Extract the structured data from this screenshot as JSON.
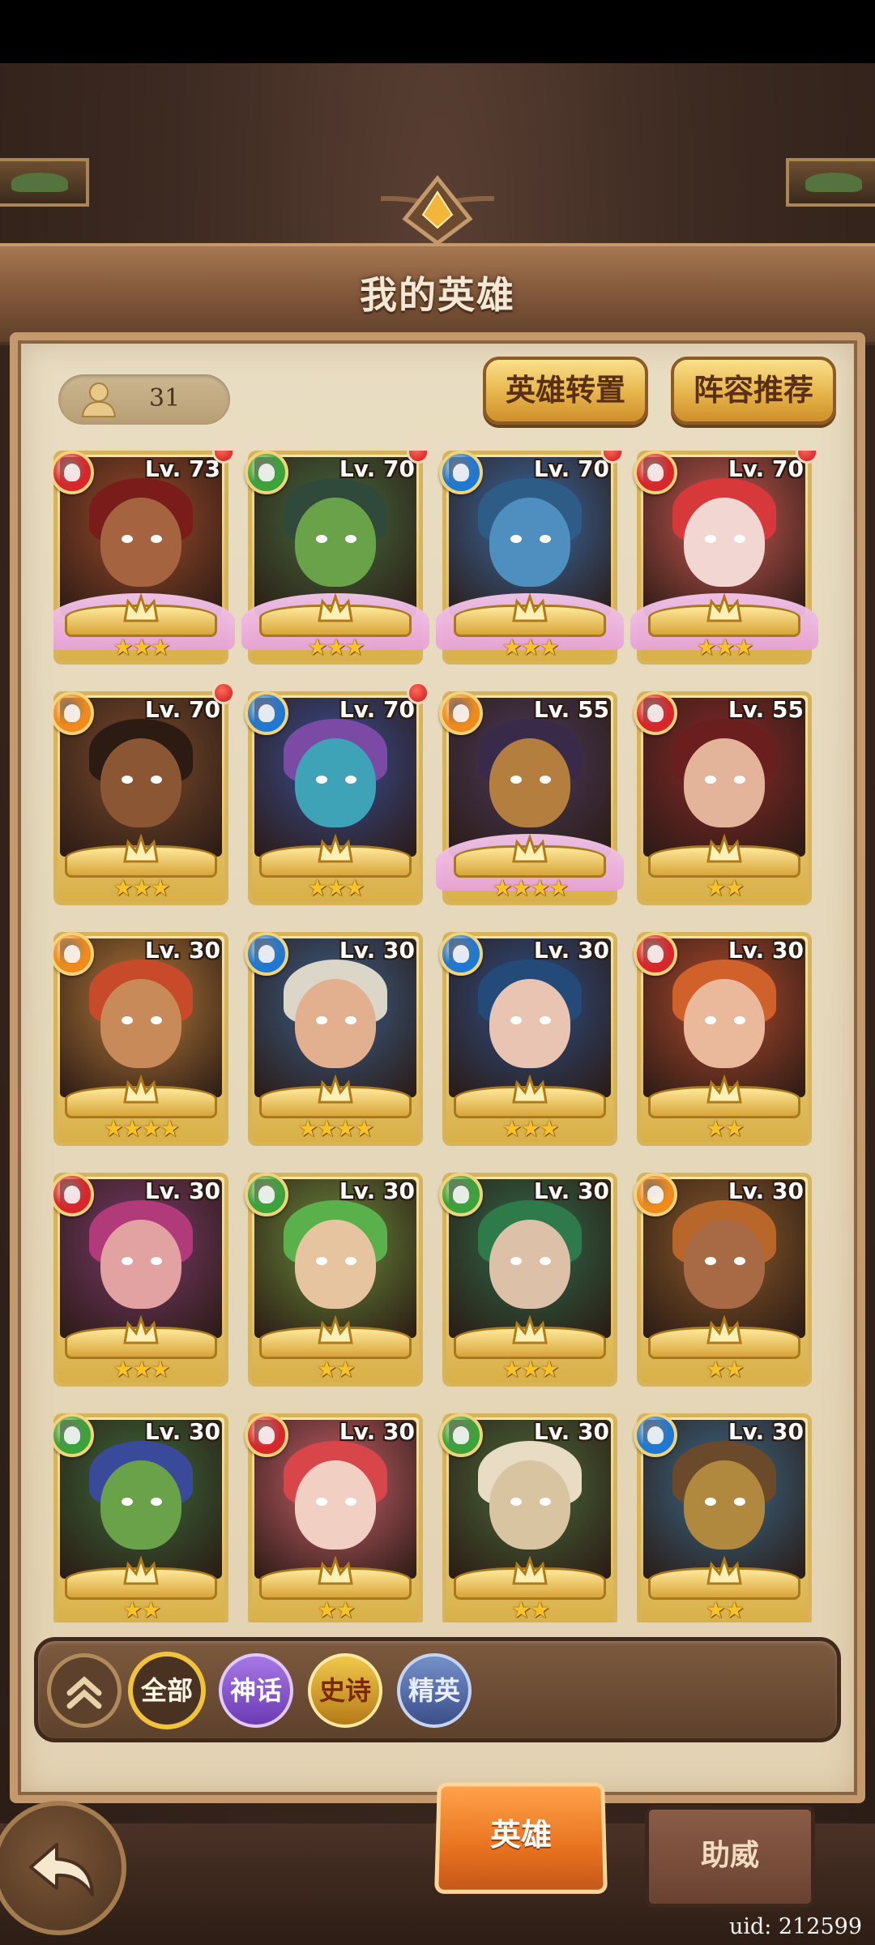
{
  "header": {
    "title": "我的英雄"
  },
  "toolbar": {
    "hero_count": "31",
    "transfer_label": "英雄转置",
    "recommend_label": "阵容推荐"
  },
  "colors": {
    "fire": "#d9262b",
    "nature": "#3aa33a",
    "water": "#1f78d1",
    "light": "#f08a1a",
    "wing": "#f3c4ea",
    "gold": "#e2b544"
  },
  "heroes": [
    {
      "level": "Lv. 73",
      "element": "fire-element-icon",
      "stars": "★★★",
      "mythic": true,
      "alert": true,
      "skin": "#a5633f",
      "hair": "#7a1c1a",
      "bg": "#9c4a2b"
    },
    {
      "level": "Lv. 70",
      "element": "nature-element-icon",
      "stars": "★★★",
      "mythic": true,
      "alert": true,
      "skin": "#6aa24a",
      "hair": "#2f4a3a",
      "bg": "#466b3d"
    },
    {
      "level": "Lv. 70",
      "element": "water-element-icon",
      "stars": "★★★",
      "mythic": true,
      "alert": true,
      "skin": "#4f8fbf",
      "hair": "#2d5c86",
      "bg": "#3a6aa5"
    },
    {
      "level": "Lv. 70",
      "element": "fire-element-icon",
      "stars": "★★★",
      "mythic": true,
      "alert": true,
      "skin": "#f2d6d2",
      "hair": "#d7383a",
      "bg": "#c95852"
    },
    {
      "level": "Lv. 70",
      "element": "light-element-icon",
      "stars": "★★★",
      "mythic": false,
      "alert": true,
      "skin": "#8a5634",
      "hair": "#2b1b12",
      "bg": "#7a4b2d"
    },
    {
      "level": "Lv. 70",
      "element": "water-element-icon",
      "stars": "★★★",
      "mythic": false,
      "alert": true,
      "skin": "#3fa3b8",
      "hair": "#7a4aa5",
      "bg": "#3a4e96"
    },
    {
      "level": "Lv. 55",
      "element": "light-element-icon",
      "stars": "★★★★",
      "mythic": true,
      "alert": false,
      "skin": "#b47e3e",
      "hair": "#3a2a4a",
      "bg": "#4a3a5a"
    },
    {
      "level": "Lv. 55",
      "element": "fire-element-icon",
      "stars": "★★",
      "mythic": false,
      "alert": false,
      "skin": "#e4b49a",
      "hair": "#6a1e1e",
      "bg": "#8a2a2a"
    },
    {
      "level": "Lv. 30",
      "element": "light-element-icon",
      "stars": "★★★★",
      "mythic": false,
      "alert": false,
      "skin": "#c98a5a",
      "hair": "#c74b2a",
      "bg": "#b47a3a"
    },
    {
      "level": "Lv. 30",
      "element": "water-element-icon",
      "stars": "★★★★",
      "mythic": false,
      "alert": false,
      "skin": "#e2b08e",
      "hair": "#dcd6c8",
      "bg": "#3b5f8a"
    },
    {
      "level": "Lv. 30",
      "element": "water-element-icon",
      "stars": "★★★",
      "mythic": false,
      "alert": false,
      "skin": "#e9c4b2",
      "hair": "#244a7a",
      "bg": "#2e4f86"
    },
    {
      "level": "Lv. 30",
      "element": "fire-element-icon",
      "stars": "★★",
      "mythic": false,
      "alert": false,
      "skin": "#eab89a",
      "hair": "#d0612a",
      "bg": "#b04a2e"
    },
    {
      "level": "Lv. 30",
      "element": "fire-element-icon",
      "stars": "★★★",
      "mythic": false,
      "alert": false,
      "skin": "#e2a2a2",
      "hair": "#b03a7a",
      "bg": "#7a3a6a"
    },
    {
      "level": "Lv. 30",
      "element": "nature-element-icon",
      "stars": "★★",
      "mythic": false,
      "alert": false,
      "skin": "#e6c4a0",
      "hair": "#5ab04a",
      "bg": "#6a8a3a"
    },
    {
      "level": "Lv. 30",
      "element": "nature-element-icon",
      "stars": "★★★",
      "mythic": false,
      "alert": false,
      "skin": "#dcc0a8",
      "hair": "#2f7a4a",
      "bg": "#2f6a4a"
    },
    {
      "level": "Lv. 30",
      "element": "light-element-icon",
      "stars": "★★",
      "mythic": false,
      "alert": false,
      "skin": "#a76a44",
      "hair": "#b8662a",
      "bg": "#8a5a2a"
    },
    {
      "level": "Lv. 30",
      "element": "nature-element-icon",
      "stars": "★★",
      "mythic": false,
      "alert": false,
      "skin": "#6aa24a",
      "hair": "#3a4a9a",
      "bg": "#3a6a3a"
    },
    {
      "level": "Lv. 30",
      "element": "fire-element-icon",
      "stars": "★★",
      "mythic": false,
      "alert": false,
      "skin": "#f1cfc2",
      "hair": "#d9464a",
      "bg": "#c8606a"
    },
    {
      "level": "Lv. 30",
      "element": "nature-element-icon",
      "stars": "★★",
      "mythic": false,
      "alert": false,
      "skin": "#d8c4a0",
      "hair": "#e8dcc4",
      "bg": "#4a6a3a"
    },
    {
      "level": "Lv. 30",
      "element": "water-element-icon",
      "stars": "★★",
      "mythic": false,
      "alert": false,
      "skin": "#b0883e",
      "hair": "#6a4a2a",
      "bg": "#3a6a8a"
    }
  ],
  "filters": {
    "all": "全部",
    "myth": "神话",
    "epic": "史诗",
    "elite": "精英"
  },
  "tabs": {
    "hero": "英雄",
    "cheer": "助威"
  },
  "footer": {
    "uid": "uid: 212599"
  }
}
